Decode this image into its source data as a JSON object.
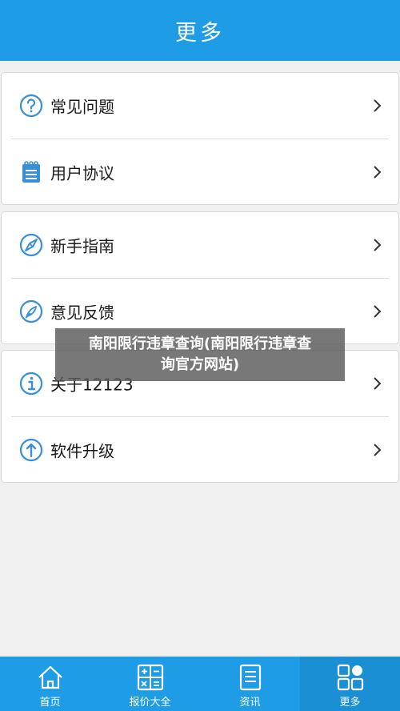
{
  "header": {
    "title": "更多"
  },
  "groups": [
    {
      "items": [
        {
          "label": "常见问题",
          "icon": "question-circle-icon"
        },
        {
          "label": "用户协议",
          "icon": "notepad-icon"
        }
      ]
    },
    {
      "items": [
        {
          "label": "新手指南",
          "icon": "compass-icon"
        },
        {
          "label": "意见反馈",
          "icon": "feather-pen-icon"
        }
      ]
    },
    {
      "items": [
        {
          "label": "关于12123",
          "icon": "info-circle-icon"
        },
        {
          "label": "软件升级",
          "icon": "upgrade-arrow-icon"
        }
      ]
    }
  ],
  "overlay": {
    "line1": "南阳限行违章查询(南阳限行违章查",
    "line2": "询官方网站)"
  },
  "tabbar": {
    "tabs": [
      {
        "label": "首页",
        "icon": "home-icon"
      },
      {
        "label": "报价大全",
        "icon": "calculator-icon"
      },
      {
        "label": "资讯",
        "icon": "document-icon"
      },
      {
        "label": "更多",
        "icon": "grid-more-icon"
      }
    ],
    "active": "更多"
  },
  "colors": {
    "primary": "#1e9de6",
    "icon_blue": "#3a8fd9",
    "background": "#f0f0f0"
  }
}
